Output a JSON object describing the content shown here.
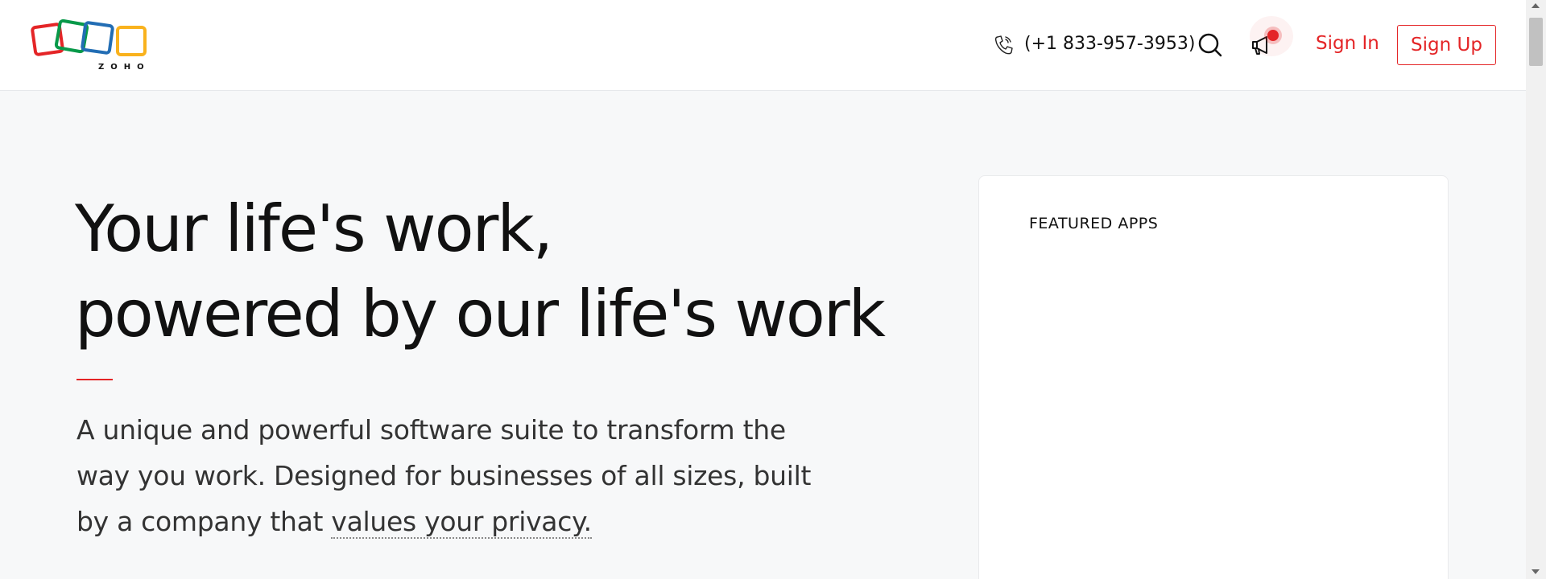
{
  "header": {
    "logo_text": "ZOHO",
    "phone": "(+1 833-957-3953)",
    "signin_label": "Sign In",
    "signup_label": "Sign Up",
    "icons": [
      "zoho-logo",
      "phone-icon",
      "search-icon",
      "megaphone-icon"
    ]
  },
  "hero": {
    "title_line1": "Your life's work,",
    "title_line2": "powered by our life's work",
    "desc_text": "A unique and powerful software suite to transform the way you work. Designed for businesses of all sizes, built by a company that ",
    "privacy_link": "values your privacy."
  },
  "featured": {
    "label": "FEATURED APPS"
  },
  "colors": {
    "brand_red": "#e42527",
    "logo_red": "#e42527",
    "logo_green": "#089949",
    "logo_blue": "#226db4",
    "logo_yellow": "#f9b21d"
  }
}
